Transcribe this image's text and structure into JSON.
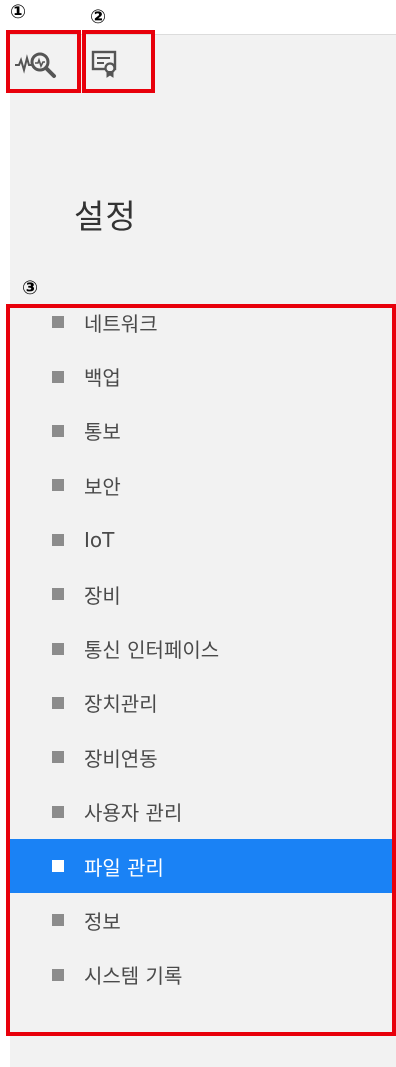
{
  "annotations": {
    "one": "①",
    "two": "②",
    "three": "③"
  },
  "toolbar": {
    "buttons": [
      {
        "icon": "activity-search-icon"
      },
      {
        "icon": "certificate-icon"
      }
    ]
  },
  "page": {
    "title": "설정"
  },
  "menu": {
    "items": [
      {
        "label": "네트워크",
        "active": false
      },
      {
        "label": "백업",
        "active": false
      },
      {
        "label": "통보",
        "active": false
      },
      {
        "label": "보안",
        "active": false
      },
      {
        "label": "IoT",
        "active": false
      },
      {
        "label": "장비",
        "active": false
      },
      {
        "label": "통신 인터페이스",
        "active": false
      },
      {
        "label": "장치관리",
        "active": false
      },
      {
        "label": "장비연동",
        "active": false
      },
      {
        "label": "사용자 관리",
        "active": false
      },
      {
        "label": "파일 관리",
        "active": true
      },
      {
        "label": "정보",
        "active": false
      },
      {
        "label": "시스템 기록",
        "active": false
      }
    ]
  },
  "colors": {
    "accent": "#1a82f5",
    "highlight_box": "#e8000b",
    "panel_bg": "#f2f2f2"
  }
}
